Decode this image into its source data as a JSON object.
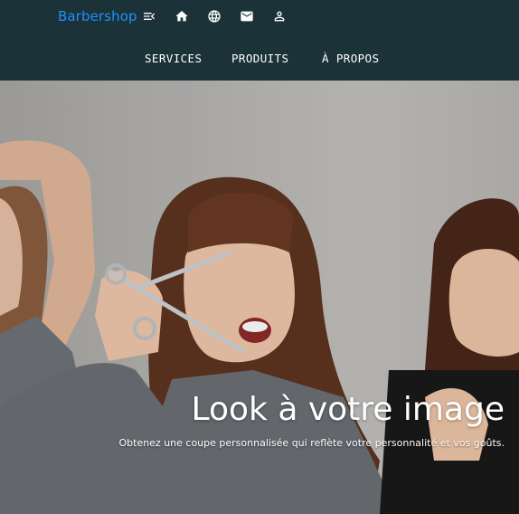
{
  "navbar": {
    "brand": "Barbershop",
    "icons": [
      "menu-open-icon",
      "home-icon",
      "globe-icon",
      "mail-icon",
      "user-icon"
    ],
    "menu": [
      {
        "label": "SERVICES"
      },
      {
        "label": "PRODUITS"
      },
      {
        "label": "À PROPOS"
      }
    ]
  },
  "hero": {
    "title": "Look à votre image",
    "subtitle": "Obtenez une coupe personnalisée qui reflète votre personnalité et vos goûts."
  },
  "colors": {
    "navbar_bg": "#1b3238",
    "brand": "#1e90ff",
    "text": "#ffffff"
  }
}
